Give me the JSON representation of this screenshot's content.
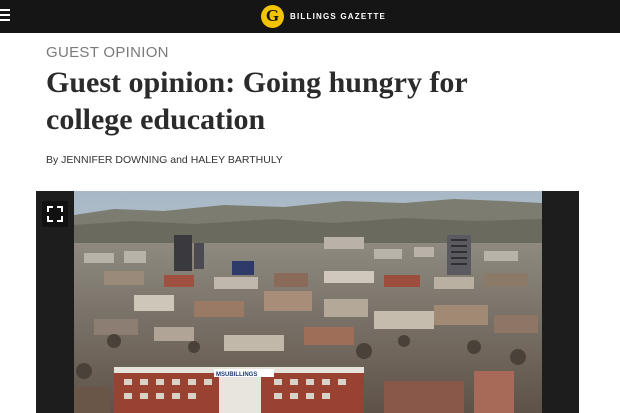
{
  "header": {
    "brand_letter": "G",
    "brand_name": "BILLINGS GAZETTE",
    "brand_color": "#f2c400",
    "icons": [
      "menu-icon",
      "expand-icon"
    ]
  },
  "article": {
    "kicker": "GUEST OPINION",
    "headline": "Guest opinion: Going hungry for college education",
    "byline": "By JENNIFER DOWNING and HALEY BARTHULY"
  },
  "photo": {
    "sign_text": "MSUBILLINGS"
  }
}
